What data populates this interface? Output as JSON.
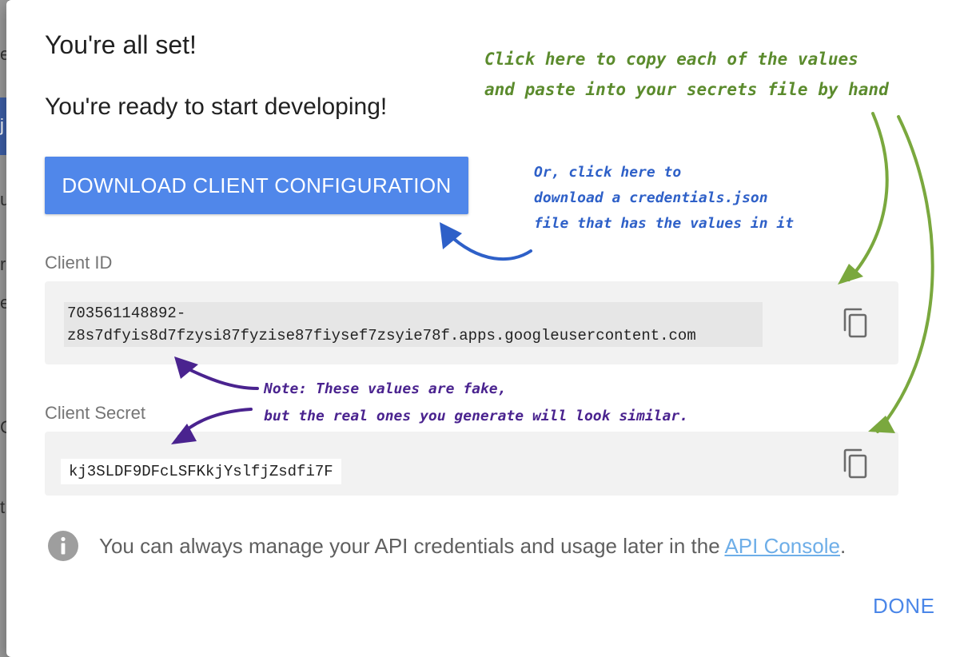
{
  "background": {
    "fragments": [
      "e",
      "j",
      "u",
      "r",
      "e",
      "C",
      "t"
    ]
  },
  "dialog": {
    "title": "You're all set!",
    "subtitle": "You're ready to start developing!",
    "download_button": "DOWNLOAD CLIENT CONFIGURATION",
    "client_id": {
      "label": "Client ID",
      "line1": "703561148892-",
      "line2": "z8s7dfyis8d7fzysi87fyzise87fiysef7zsyie78f.apps.googleusercontent.com",
      "copy_icon": "copy-icon"
    },
    "client_secret": {
      "label": "Client Secret",
      "value": "kj3SLDF9DFcLSFKkjYslfjZsdfi7F",
      "copy_icon": "copy-icon"
    },
    "info": {
      "icon": "info-icon",
      "text_before": "You can always manage your API credentials and usage later in the ",
      "link": "API Console",
      "text_after": "."
    },
    "done_button": "DONE"
  },
  "annotations": {
    "green": {
      "line1": "Click here to copy each of the values",
      "line2": "and paste into your secrets file by hand",
      "color": "#5b8b2d"
    },
    "blue": {
      "line1": "Or, click here to",
      "line2": "download a credentials.json",
      "line3": "file that has the values in it",
      "color": "#2e60c8"
    },
    "purple": {
      "line1": "Note: These values are fake,",
      "line2": "but the real ones you generate will look similar.",
      "color": "#4a238f"
    }
  },
  "colors": {
    "primary_button": "#5087ea",
    "done": "#4a86e8",
    "link": "#6eaee8",
    "field_bg": "#f2f2f2"
  }
}
